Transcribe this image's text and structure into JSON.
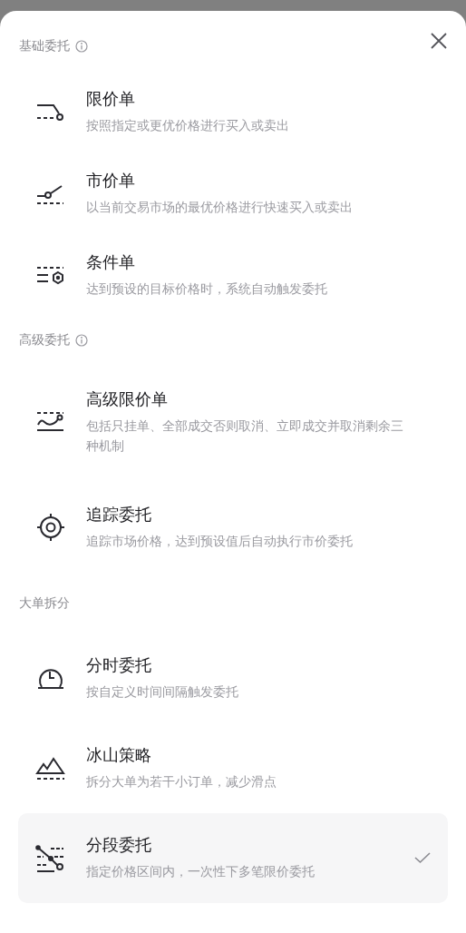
{
  "sections": [
    {
      "title": "基础委托",
      "info": true,
      "items": [
        {
          "title": "限价单",
          "description": "按照指定或更优价格进行买入或卖出",
          "selected": false
        },
        {
          "title": "市价单",
          "description": "以当前交易市场的最优价格进行快速买入或卖出",
          "selected": false
        },
        {
          "title": "条件单",
          "description": "达到预设的目标价格时，系统自动触发委托",
          "selected": false
        }
      ]
    },
    {
      "title": "高级委托",
      "info": true,
      "items": [
        {
          "title": "高级限价单",
          "description": "包括只挂单、全部成交否则取消、立即成交并取消剩余三种机制",
          "selected": false
        },
        {
          "title": "追踪委托",
          "description": "追踪市场价格，达到预设值后自动执行市价委托",
          "selected": false
        }
      ]
    },
    {
      "title": "大单拆分",
      "info": false,
      "items": [
        {
          "title": "分时委托",
          "description": "按自定义时间间隔触发委托",
          "selected": false
        },
        {
          "title": "冰山策略",
          "description": "拆分大单为若干小订单，减少滑点",
          "selected": false
        },
        {
          "title": "分段委托",
          "description": "指定价格区间内，一次性下多笔限价委托",
          "selected": true
        }
      ]
    }
  ]
}
